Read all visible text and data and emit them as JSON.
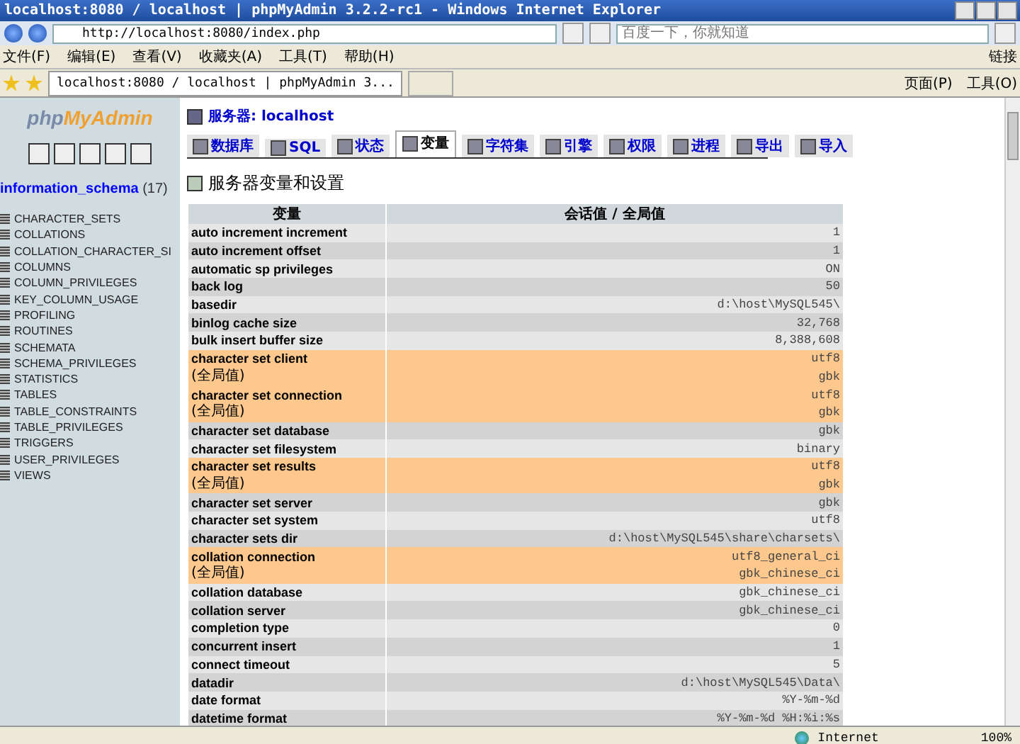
{
  "window": {
    "title": "localhost:8080 / localhost | phpMyAdmin 3.2.2-rc1 - Windows Internet Explorer"
  },
  "address_bar": {
    "url": "http://localhost:8080/index.php",
    "search_placeholder": "百度一下，你就知道"
  },
  "menu": [
    "文件(F)",
    "编辑(E)",
    "查看(V)",
    "收藏夹(A)",
    "工具(T)",
    "帮助(H)"
  ],
  "links_label": "链接",
  "browser_tabs": [
    {
      "label": "localhost:8080 / localhost | phpMyAdmin 3...",
      "selected": true
    }
  ],
  "command_bar": [
    "页面(P)",
    "工具(O)"
  ],
  "sidebar": {
    "logo_prefix": "php",
    "logo_suffix": "MyAdmin",
    "database": "information_schema",
    "count": "(17)",
    "tables": [
      "CHARACTER_SETS",
      "COLLATIONS",
      "COLLATION_CHARACTER_SI",
      "COLUMNS",
      "COLUMN_PRIVILEGES",
      "KEY_COLUMN_USAGE",
      "PROFILING",
      "ROUTINES",
      "SCHEMATA",
      "SCHEMA_PRIVILEGES",
      "STATISTICS",
      "TABLES",
      "TABLE_CONSTRAINTS",
      "TABLE_PRIVILEGES",
      "TRIGGERS",
      "USER_PRIVILEGES",
      "VIEWS"
    ]
  },
  "server": {
    "label": "服务器:",
    "host": "localhost"
  },
  "tabs": [
    {
      "label": "数据库",
      "selected": false
    },
    {
      "label": "SQL",
      "selected": false
    },
    {
      "label": "状态",
      "selected": false
    },
    {
      "label": "变量",
      "selected": true
    },
    {
      "label": "字符集",
      "selected": false
    },
    {
      "label": "引擎",
      "selected": false
    },
    {
      "label": "权限",
      "selected": false
    },
    {
      "label": "进程",
      "selected": false
    },
    {
      "label": "导出",
      "selected": false
    },
    {
      "label": "导入",
      "selected": false
    }
  ],
  "heading": "服务器变量和设置",
  "table": {
    "columns": [
      "变量",
      "会话值 / 全局值"
    ],
    "rows": [
      {
        "name": "auto increment increment",
        "value": "1",
        "highlight": false
      },
      {
        "name": "auto increment offset",
        "value": "1",
        "highlight": false
      },
      {
        "name": "automatic sp privileges",
        "value": "ON",
        "highlight": false
      },
      {
        "name": "back log",
        "value": "50",
        "highlight": false
      },
      {
        "name": "basedir",
        "value": "d:\\host\\MySQL545\\",
        "highlight": false
      },
      {
        "name": "binlog cache size",
        "value": "32,768",
        "highlight": false
      },
      {
        "name": "bulk insert buffer size",
        "value": "8,388,608",
        "highlight": false
      },
      {
        "name": "character set client",
        "value": "utf8",
        "highlight": true
      },
      {
        "name": "(全局值)",
        "value": "gbk",
        "highlight": true
      },
      {
        "name": "character set connection",
        "value": "utf8",
        "highlight": true
      },
      {
        "name": "(全局值)",
        "value": "gbk",
        "highlight": true
      },
      {
        "name": "character set database",
        "value": "gbk",
        "highlight": false
      },
      {
        "name": "character set filesystem",
        "value": "binary",
        "highlight": false
      },
      {
        "name": "character set results",
        "value": "utf8",
        "highlight": true
      },
      {
        "name": "(全局值)",
        "value": "gbk",
        "highlight": true
      },
      {
        "name": "character set server",
        "value": "gbk",
        "highlight": false
      },
      {
        "name": "character set system",
        "value": "utf8",
        "highlight": false
      },
      {
        "name": "character sets dir",
        "value": "d:\\host\\MySQL545\\share\\charsets\\",
        "highlight": false
      },
      {
        "name": "collation connection",
        "value": "utf8_general_ci",
        "highlight": true
      },
      {
        "name": "(全局值)",
        "value": "gbk_chinese_ci",
        "highlight": true
      },
      {
        "name": "collation database",
        "value": "gbk_chinese_ci",
        "highlight": false
      },
      {
        "name": "collation server",
        "value": "gbk_chinese_ci",
        "highlight": false
      },
      {
        "name": "completion type",
        "value": "0",
        "highlight": false
      },
      {
        "name": "concurrent insert",
        "value": "1",
        "highlight": false
      },
      {
        "name": "connect timeout",
        "value": "5",
        "highlight": false
      },
      {
        "name": "datadir",
        "value": "d:\\host\\MySQL545\\Data\\",
        "highlight": false
      },
      {
        "name": "date format",
        "value": "%Y-%m-%d",
        "highlight": false
      },
      {
        "name": "datetime format",
        "value": "%Y-%m-%d %H:%i:%s",
        "highlight": false
      }
    ]
  },
  "status_bar": {
    "zone": "Internet",
    "zoom": "100%"
  }
}
